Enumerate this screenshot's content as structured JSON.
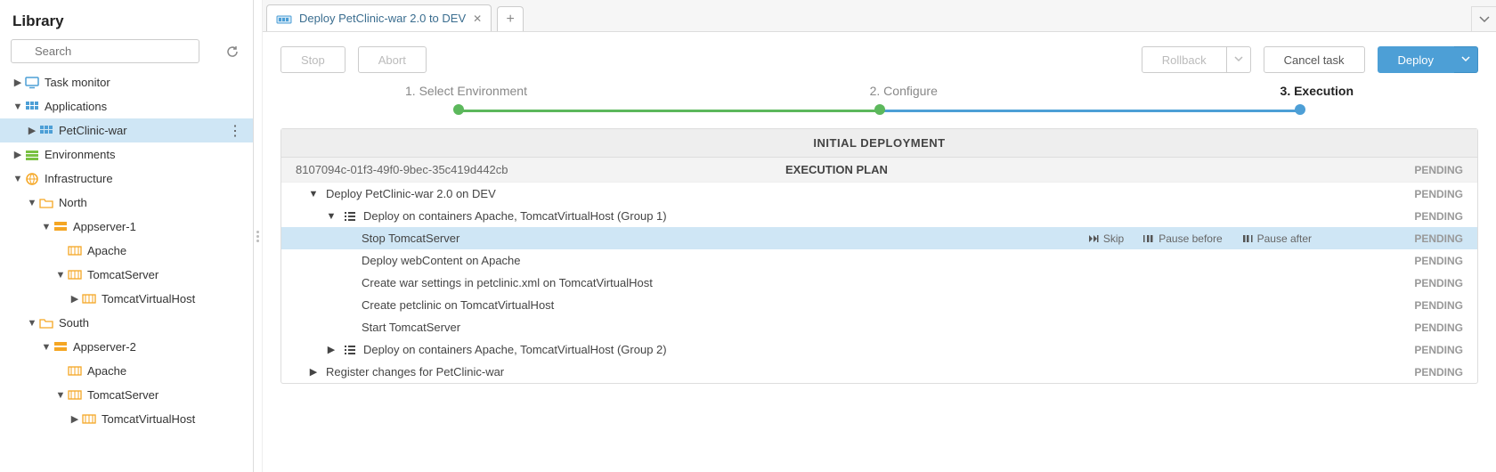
{
  "sidebar": {
    "title": "Library",
    "search_placeholder": "Search",
    "tree": [
      {
        "label": "Task monitor"
      },
      {
        "label": "Applications"
      },
      {
        "label": "PetClinic-war"
      },
      {
        "label": "Environments"
      },
      {
        "label": "Infrastructure"
      },
      {
        "label": "North"
      },
      {
        "label": "Appserver-1"
      },
      {
        "label": "Apache"
      },
      {
        "label": "TomcatServer"
      },
      {
        "label": "TomcatVirtualHost"
      },
      {
        "label": "South"
      },
      {
        "label": "Appserver-2"
      },
      {
        "label": "Apache"
      },
      {
        "label": "TomcatServer"
      },
      {
        "label": "TomcatVirtualHost"
      }
    ]
  },
  "tab": {
    "label": "Deploy PetClinic-war 2.0 to DEV"
  },
  "actions": {
    "stop": "Stop",
    "abort": "Abort",
    "rollback": "Rollback",
    "cancel": "Cancel task",
    "deploy": "Deploy"
  },
  "wizard": {
    "step1": "1. Select Environment",
    "step2": "2. Configure",
    "step3": "3. Execution"
  },
  "panel": {
    "header": "INITIAL DEPLOYMENT",
    "plan_id": "8107094c-01f3-49f0-9bec-35c419d442cb",
    "plan_label": "EXECUTION PLAN",
    "pending": "PENDING",
    "rows": [
      {
        "label": "Deploy PetClinic-war 2.0 on DEV"
      },
      {
        "label": "Deploy on containers Apache, TomcatVirtualHost (Group 1)"
      },
      {
        "label": "Stop TomcatServer"
      },
      {
        "label": "Deploy webContent on Apache"
      },
      {
        "label": "Create war settings in petclinic.xml on TomcatVirtualHost"
      },
      {
        "label": "Create petclinic on TomcatVirtualHost"
      },
      {
        "label": "Start TomcatServer"
      },
      {
        "label": "Deploy on containers Apache, TomcatVirtualHost (Group 2)"
      },
      {
        "label": "Register changes for PetClinic-war"
      }
    ],
    "row_actions": {
      "skip": "Skip",
      "pause_before": "Pause before",
      "pause_after": "Pause after"
    }
  }
}
